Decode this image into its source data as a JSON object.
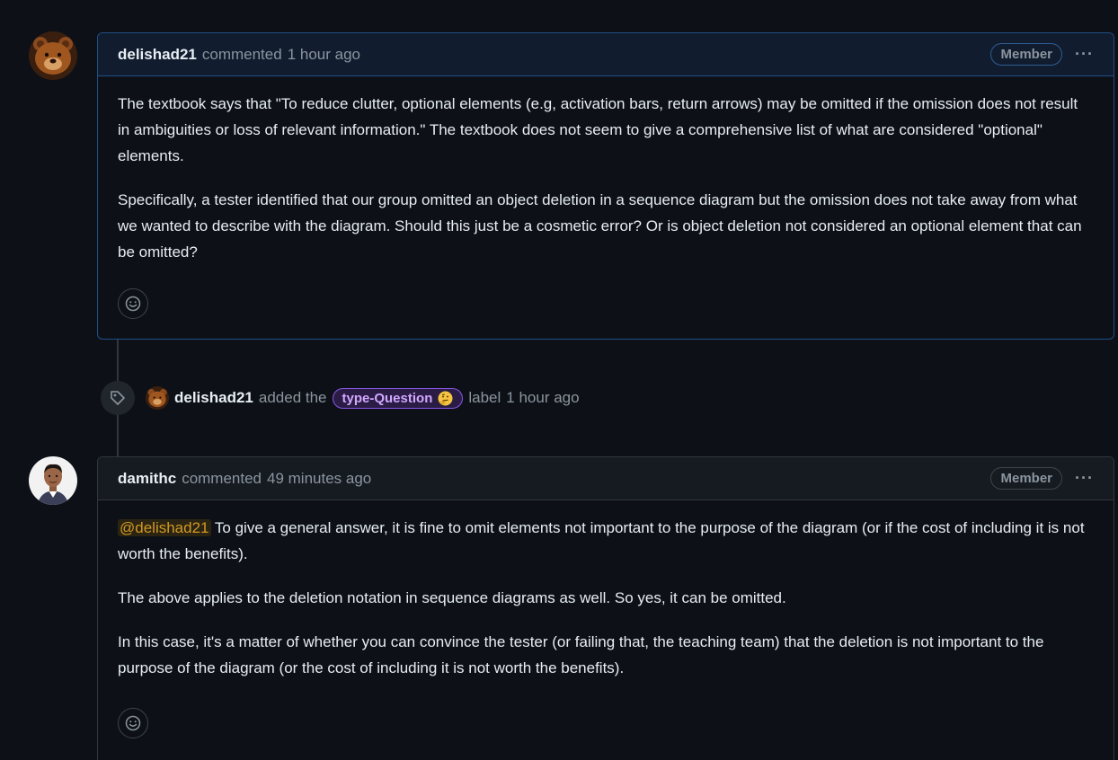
{
  "comments": [
    {
      "author": "delishad21",
      "action": "commented",
      "time": "1 hour ago",
      "role_badge": "Member",
      "menu_label": "···",
      "avatar_icon": "bear-avatar",
      "paragraphs": [
        "The textbook says that \"To reduce clutter, optional elements (e.g, activation bars, return arrows) may be omitted if the omission does not result in ambiguities or loss of relevant information.\" The textbook does not seem to give a comprehensive list of what are considered \"optional\" elements.",
        "Specifically, a tester identified that our group omitted an object deletion in a sequence diagram but the omission does not take away from what we wanted to describe with the diagram. Should this just be a cosmetic error? Or is object deletion not considered an optional element that can be omitted?"
      ]
    },
    {
      "author": "damithc",
      "action": "commented",
      "time": "49 minutes ago",
      "role_badge": "Member",
      "menu_label": "···",
      "avatar_icon": "person-avatar",
      "mention": "@delishad21",
      "paragraph_after_mention": " To give a general answer, it is fine to omit elements not important to the purpose of the diagram (or if the cost of including it is not worth the benefits).",
      "paragraphs": [
        "The above applies to the deletion notation in sequence diagrams as well. So yes, it can be omitted.",
        "In this case, it's a matter of whether you can convince the tester (or failing that, the teaching team) that the deletion is not important to the purpose of the diagram (or the cost of including it is not worth the benefits)."
      ]
    }
  ],
  "event": {
    "icon": "tag-icon",
    "actor": "delishad21",
    "action_before": "added the",
    "label_name": "type-Question",
    "label_emoji": "thinking-face-icon",
    "action_after": "label",
    "time": "1 hour ago"
  },
  "colors": {
    "background": "#0d1117",
    "accent_border": "#1f4f86",
    "label": "#d2a8ff",
    "mention": "#d29922"
  }
}
